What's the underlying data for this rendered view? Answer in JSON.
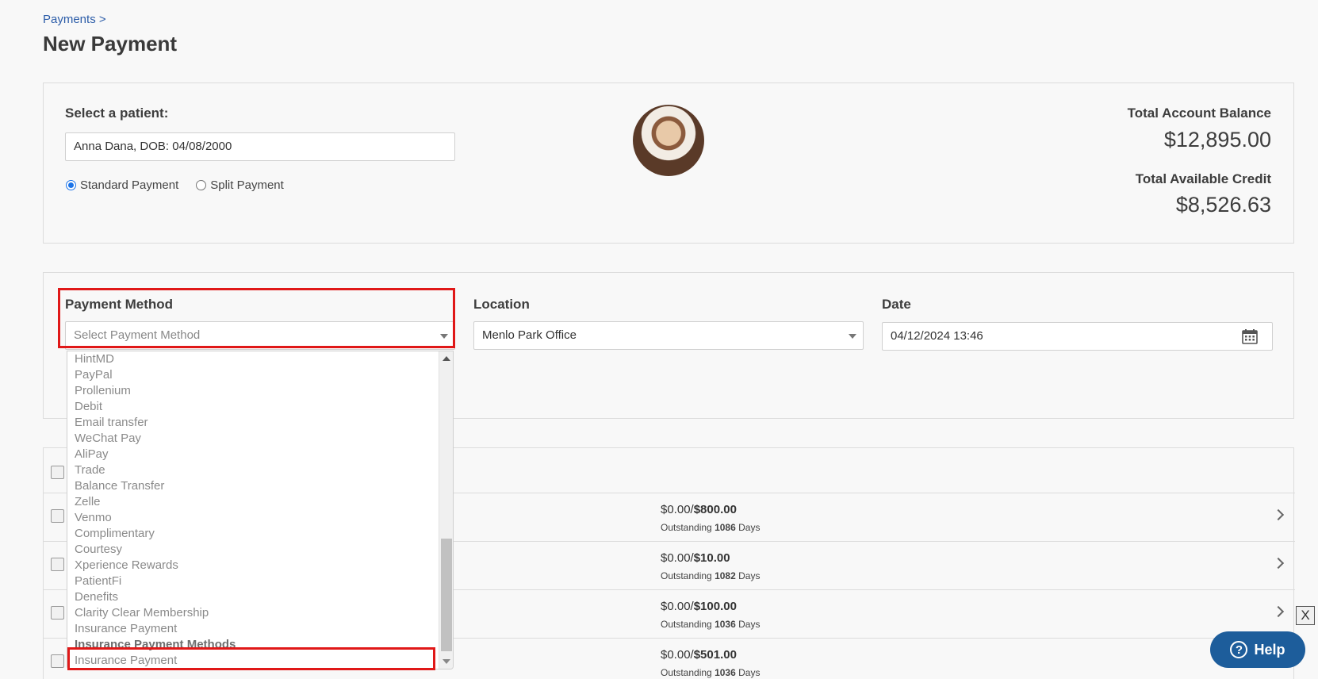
{
  "breadcrumb": "Payments >",
  "page_title": "New Payment",
  "patient": {
    "label": "Select a patient:",
    "value": "Anna Dana, DOB: 04/08/2000",
    "radio_standard": "Standard Payment",
    "radio_split": "Split Payment",
    "selected": "Standard Payment"
  },
  "balance": {
    "total_account_label": "Total Account Balance",
    "total_account_value": "$12,895.00",
    "total_credit_label": "Total Available Credit",
    "total_credit_value": "$8,526.63"
  },
  "payment_method": {
    "label": "Payment Method",
    "placeholder": "Select Payment Method",
    "options": [
      "HintMD",
      "PayPal",
      "Prollenium",
      "Debit",
      "Email transfer",
      "WeChat Pay",
      "AliPay",
      "Trade",
      "Balance Transfer",
      "Zelle",
      "Venmo",
      "Complimentary",
      "Courtesy",
      "Xperience Rewards",
      "PatientFi",
      "Denefits",
      "Clarity Clear Membership",
      "Insurance Payment"
    ],
    "group_label": "Insurance Payment Methods",
    "group_options": [
      "Insurance Payment"
    ]
  },
  "location": {
    "label": "Location",
    "value": "Menlo Park Office"
  },
  "date": {
    "label": "Date",
    "value": "04/12/2024 13:46"
  },
  "invoices": [
    {
      "paid": "$0.00/",
      "total": "$800.00",
      "outstanding_prefix": "Outstanding",
      "days": "1086",
      "days_suffix": "Days"
    },
    {
      "paid": "$0.00/",
      "total": "$10.00",
      "outstanding_prefix": "Outstanding",
      "days": "1082",
      "days_suffix": "Days"
    },
    {
      "paid": "$0.00/",
      "total": "$100.00",
      "outstanding_prefix": "Outstanding",
      "days": "1036",
      "days_suffix": "Days"
    },
    {
      "paid": "$0.00/",
      "total": "$501.00",
      "outstanding_prefix": "Outstanding",
      "days": "1036",
      "days_suffix": "Days"
    }
  ],
  "help": {
    "label": "Help"
  },
  "close": {
    "label": "X"
  },
  "icons": {
    "calendar": "calendar-icon",
    "chevron": "chevron-right-icon",
    "help": "question-icon"
  },
  "colors": {
    "link": "#2b5ca8",
    "highlight": "#e01818",
    "help_button": "#1d5d9b",
    "radio_accent": "#1a73e8"
  }
}
